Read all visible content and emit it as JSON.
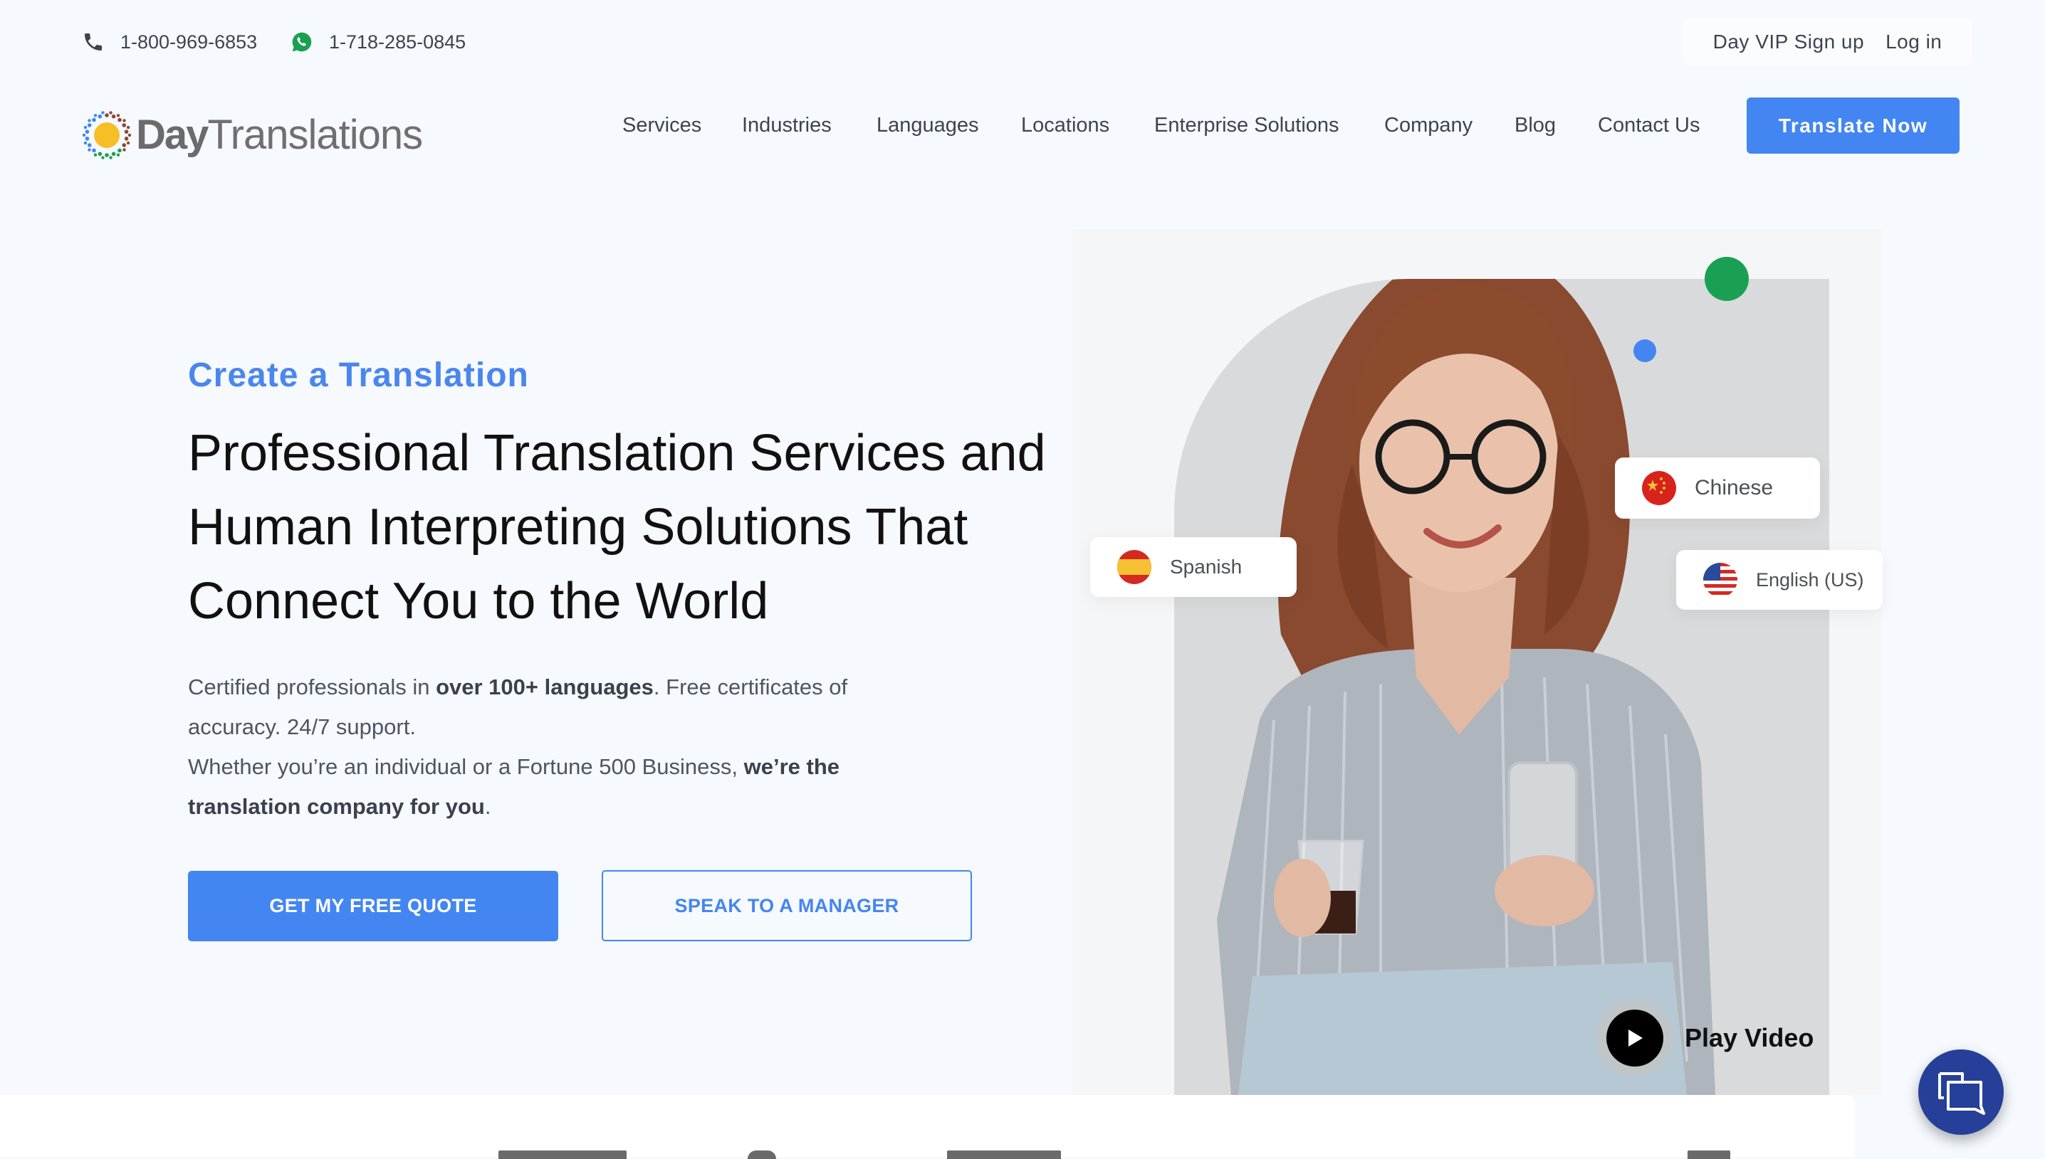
{
  "topbar": {
    "phone": {
      "icon": "phone-icon",
      "number": "1-800-969-6853"
    },
    "whatsapp": {
      "icon": "whatsapp-icon",
      "number": "1-718-285-0845"
    },
    "vip_signup": "Day VIP Sign up",
    "login": "Log in"
  },
  "brand": {
    "logo_bold": "Day",
    "logo_regular": "Translations"
  },
  "nav": {
    "items": [
      "Services",
      "Industries",
      "Languages",
      "Locations",
      "Enterprise Solutions",
      "Company",
      "Blog",
      "Contact Us"
    ],
    "cta": "Translate Now"
  },
  "hero": {
    "eyebrow": "Create a Translation",
    "title_lines": [
      "Professional Translation Services and",
      "Human Interpreting Solutions That",
      "Connect You to the World"
    ],
    "para": {
      "p1_a": "Certified professionals in ",
      "p1_b": "over 100+ languages",
      "p1_c": ". Free certificates of accuracy. 24/7 support.",
      "p2_a": "Whether you’re an individual or a Fortune 500 Business, ",
      "p2_b": "we’re the translation company for you",
      "p2_c": "."
    },
    "primary_button": "GET MY FREE QUOTE",
    "secondary_button": "SPEAK TO A MANAGER"
  },
  "media": {
    "languages": [
      {
        "label": "Spanish",
        "flag": "spain-flag-icon"
      },
      {
        "label": "Chinese",
        "flag": "china-flag-icon"
      },
      {
        "label": "English (US)",
        "flag": "us-flag-icon"
      }
    ],
    "play_label": "Play Video"
  },
  "colors": {
    "accent": "#4386f2",
    "chat": "#263f99",
    "green_dot": "#1aa053",
    "blue_dot": "#4386f2"
  }
}
